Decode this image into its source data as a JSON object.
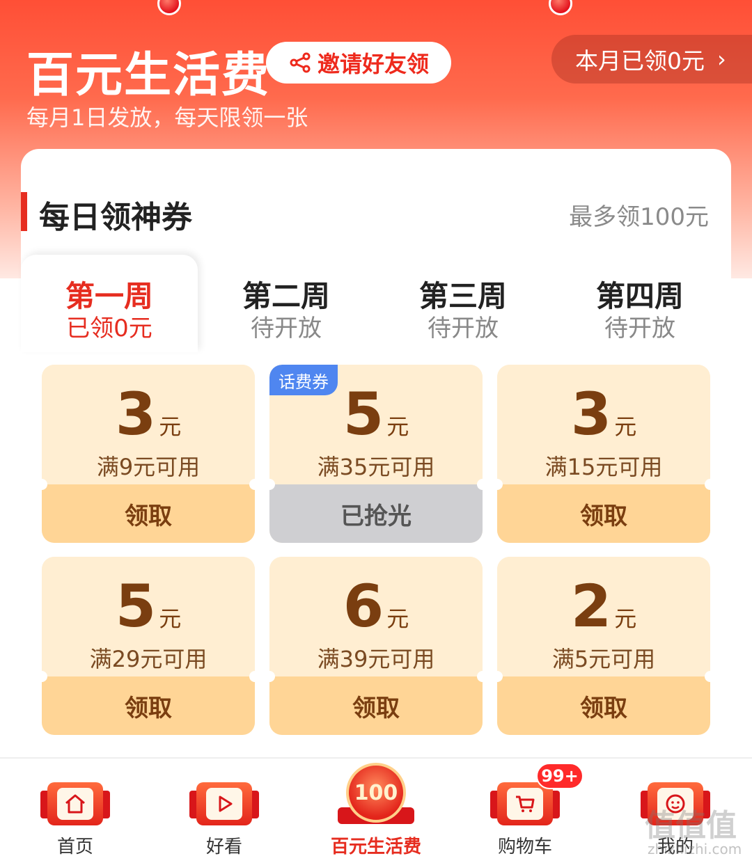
{
  "header": {
    "title": "百元生活费",
    "invite_label": "邀请好友领",
    "month_claimed": "本月已领0元",
    "chevron": "›",
    "subtitle": "每月1日发放，每天限领一张"
  },
  "section": {
    "title": "每日领神券",
    "note": "最多领100元"
  },
  "tabs": [
    {
      "name": "第一周",
      "status": "已领0元"
    },
    {
      "name": "第二周",
      "status": "待开放"
    },
    {
      "name": "第三周",
      "status": "待开放"
    },
    {
      "name": "第四周",
      "status": "待开放"
    }
  ],
  "coupons": [
    {
      "amount": "3",
      "unit": "元",
      "condition": "满9元可用",
      "button": "领取"
    },
    {
      "amount": "5",
      "unit": "元",
      "condition": "满35元可用",
      "button": "已抢光",
      "badge": "话费券"
    },
    {
      "amount": "3",
      "unit": "元",
      "condition": "满15元可用",
      "button": "领取"
    },
    {
      "amount": "5",
      "unit": "元",
      "condition": "满29元可用",
      "button": "领取"
    },
    {
      "amount": "6",
      "unit": "元",
      "condition": "满39元可用",
      "button": "领取"
    },
    {
      "amount": "2",
      "unit": "元",
      "condition": "满5元可用",
      "button": "领取"
    }
  ],
  "nav": [
    {
      "label": "首页",
      "icon": "home-icon"
    },
    {
      "label": "好看",
      "icon": "play-icon"
    },
    {
      "label": "百元生活费",
      "icon": "hundred-badge-icon",
      "center_text": "100"
    },
    {
      "label": "购物车",
      "icon": "cart-icon",
      "badge": "99+"
    },
    {
      "label": "我的",
      "icon": "profile-face-icon"
    }
  ],
  "watermark": {
    "text": "值值值",
    "sub": "zhizhizhi.com"
  },
  "colors": {
    "accent": "#e62d20",
    "coupon_bg": "#ffeed2",
    "coupon_btn": "#ffd596",
    "sold_btn": "#cfcfd2",
    "badge_blue": "#4f86f0"
  }
}
